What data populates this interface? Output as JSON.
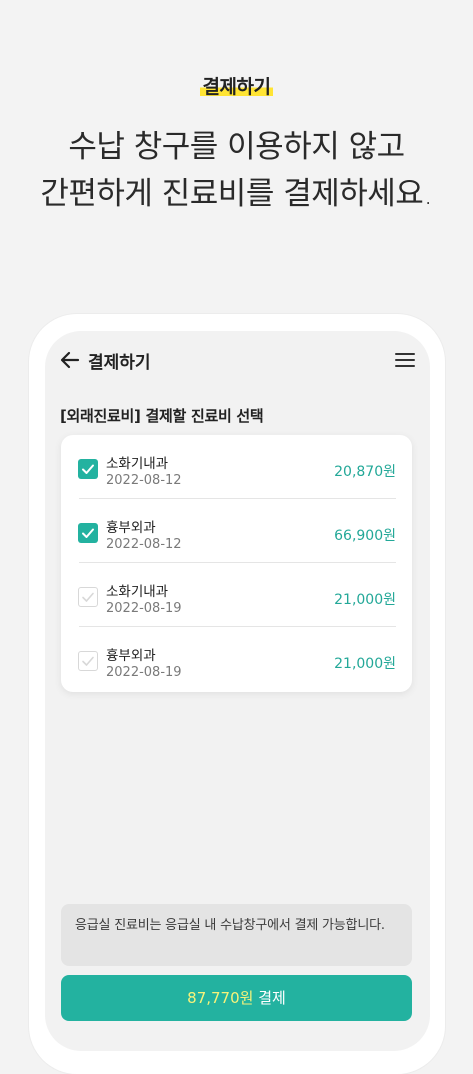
{
  "intro": {
    "tag": "결제하기",
    "headline_line1": "수납 창구를 이용하지 않고",
    "headline_line2": "간편하게 진료비를 결제하세요."
  },
  "appbar": {
    "title": "결제하기",
    "back_icon": "arrow-left-icon",
    "menu_icon": "hamburger-menu-icon"
  },
  "section": {
    "title": "[외래진료비] 결제할 진료비 선택"
  },
  "bills": [
    {
      "department": "소화기내과",
      "date": "2022-08-12",
      "amount": "20,870원",
      "checked": true
    },
    {
      "department": "흉부외과",
      "date": "2022-08-12",
      "amount": "66,900원",
      "checked": true
    },
    {
      "department": "소화기내과",
      "date": "2022-08-19",
      "amount": "21,000원",
      "checked": false
    },
    {
      "department": "흉부외과",
      "date": "2022-08-19",
      "amount": "21,000원",
      "checked": false
    }
  ],
  "notice": {
    "text": "응급실 진료비는 응급실 내 수납창구에서 결제 가능합니다."
  },
  "pay_button": {
    "amount": "87,770원",
    "label": " 결제"
  },
  "colors": {
    "accent": "#23b2a0",
    "highlight": "#ffe433",
    "pay_amount": "#f7f37a"
  }
}
